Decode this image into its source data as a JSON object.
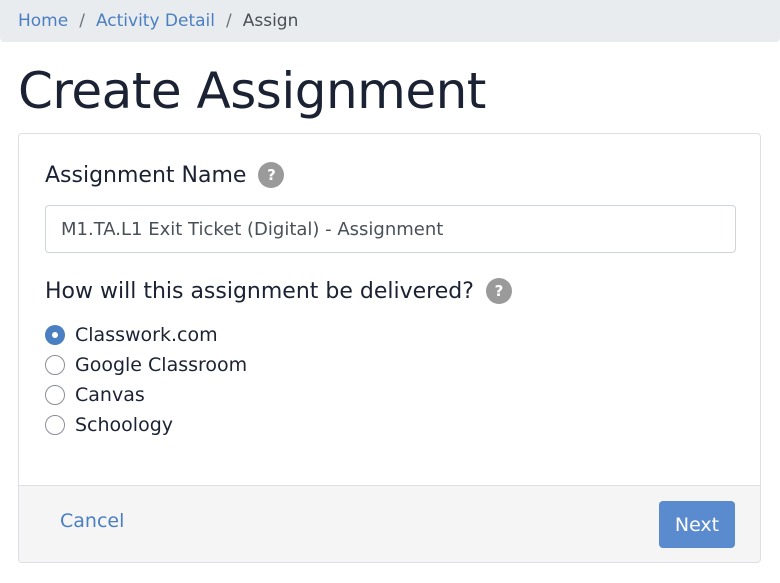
{
  "breadcrumb": {
    "items": [
      {
        "label": "Home",
        "link": true
      },
      {
        "label": "Activity Detail",
        "link": true
      },
      {
        "label": "Assign",
        "link": false
      }
    ],
    "separator": "/"
  },
  "page": {
    "title": "Create Assignment"
  },
  "form": {
    "name_label": "Assignment Name",
    "name_value": "M1.TA.L1 Exit Ticket (Digital) - Assignment",
    "help_glyph": "?",
    "delivery_label": "How will this assignment be delivered?",
    "delivery_options": [
      {
        "label": "Classwork.com",
        "selected": true
      },
      {
        "label": "Google Classroom",
        "selected": false
      },
      {
        "label": "Canvas",
        "selected": false
      },
      {
        "label": "Schoology",
        "selected": false
      }
    ]
  },
  "footer": {
    "cancel_label": "Cancel",
    "next_label": "Next"
  },
  "colors": {
    "accent": "#4a7fc1",
    "button": "#5b8bcf",
    "help": "#9a9a9a"
  }
}
